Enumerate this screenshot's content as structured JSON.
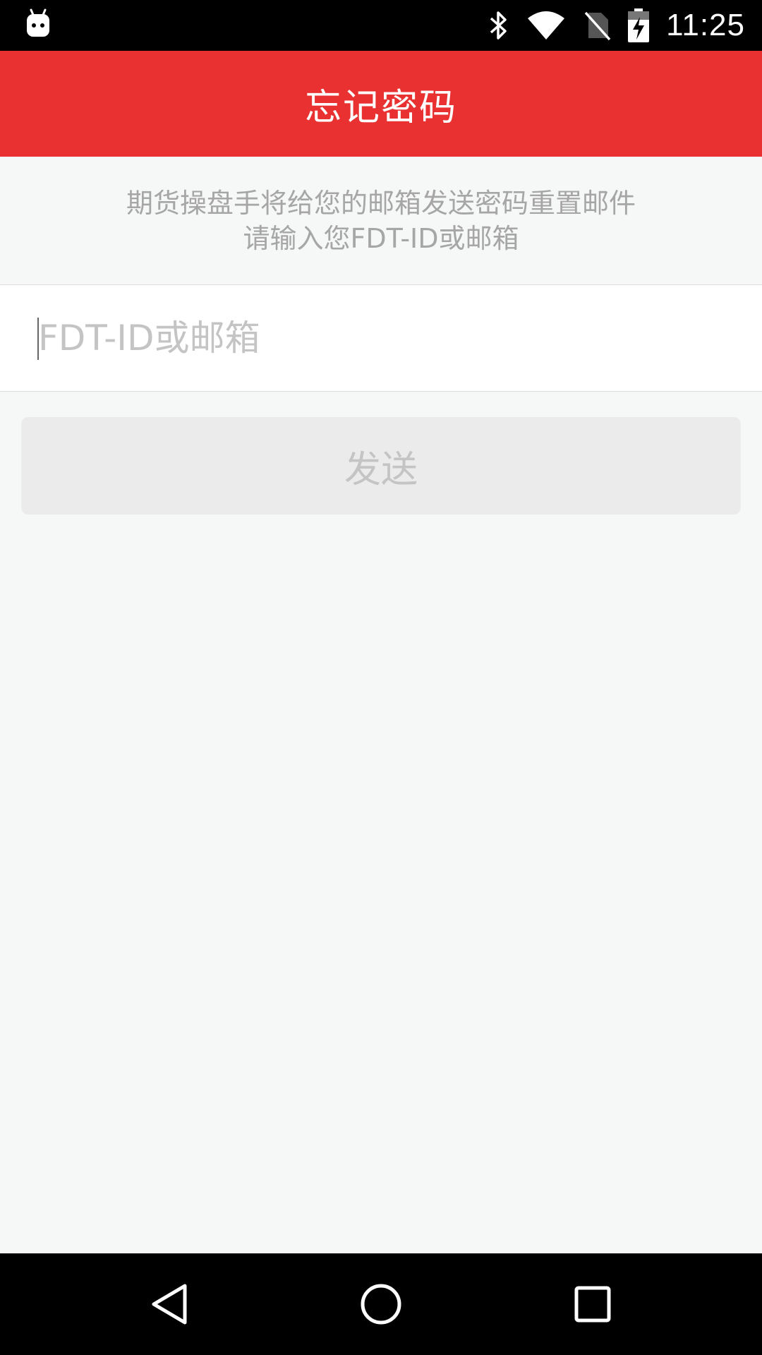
{
  "status_bar": {
    "time": "11:25",
    "icons": [
      "android-debug-icon",
      "bluetooth-icon",
      "wifi-icon",
      "no-sim-icon",
      "battery-charging-icon"
    ]
  },
  "app_bar": {
    "title": "忘记密码"
  },
  "info": {
    "line1": "期货操盘手将给您的邮箱发送密码重置邮件",
    "line2": "请输入您FDT-ID或邮箱"
  },
  "form": {
    "account_placeholder": "FDT-ID或邮箱",
    "account_value": "",
    "send_label": "发送"
  },
  "nav_bar": {
    "icons": [
      "back-icon",
      "home-icon",
      "recents-icon"
    ]
  },
  "colors": {
    "accent": "#e93131",
    "background": "#f6f7f7",
    "button_disabled": "#ebebeb",
    "text_hint": "#a6a6a6"
  }
}
